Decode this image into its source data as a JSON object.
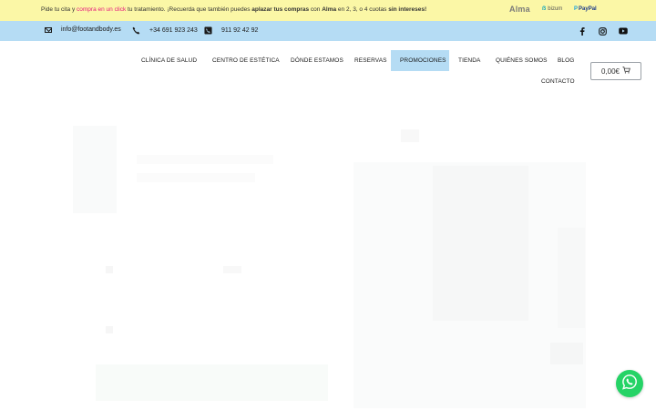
{
  "promo_bar": {
    "text_1": "Pide tu cita y ",
    "text_link": "compra en un click",
    "text_2": " tu tratamiento. ¡Recuerda que también puedes ",
    "text_bold_1": "aplazar tus compras",
    "text_3": " con ",
    "text_bold_2": "Alma",
    "text_4": " en 2, 3, o 4 cuotas ",
    "text_bold_3": "sin intereses!",
    "payment_logos": {
      "alma": "Alma",
      "bizum": "bizum",
      "paypal": "PayPal"
    }
  },
  "contact_bar": {
    "email": "info@footandbody.es",
    "phone": "+34 691 923 243",
    "landline": "911 92 42 92",
    "social_icons": [
      "facebook-icon",
      "instagram-icon",
      "youtube-icon"
    ]
  },
  "nav": {
    "items": [
      {
        "label": "Clínica de Salud"
      },
      {
        "label": "Centro de Estética"
      },
      {
        "label": "Dónde Estamos"
      },
      {
        "label": "Reservas"
      },
      {
        "label": "Promociones",
        "active": true
      },
      {
        "label": "Tienda"
      },
      {
        "label": "Quiénes Somos"
      },
      {
        "label": "Blog"
      },
      {
        "label": "Contacto"
      }
    ],
    "cart_total": "0,00€"
  },
  "colors": {
    "promo_bg": "#fbf7a6",
    "contact_bg": "#b5dcf4",
    "active_nav_bg": "#b5dcf4",
    "link_pink": "#e6197e",
    "whatsapp_green": "#25d366"
  }
}
